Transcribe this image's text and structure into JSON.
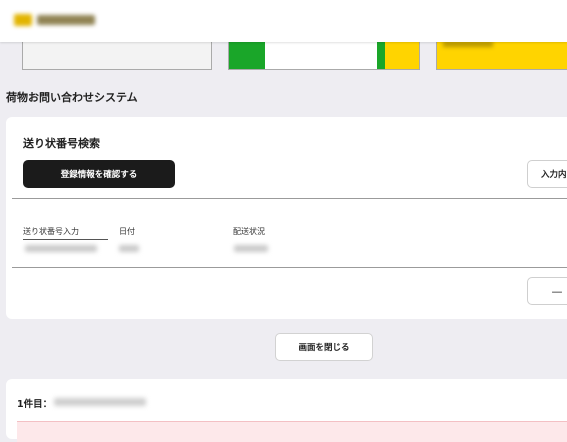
{
  "header": {
    "logo": "logo"
  },
  "banners": [
    "banner-left",
    "banner-middle",
    "banner-right"
  ],
  "page": {
    "title": "荷物お問い合わせシステム"
  },
  "search_card": {
    "title": "送り状番号検索",
    "confirm_button": "登録情報を確認する",
    "side_button": "入力内",
    "columns": [
      "送り状番号入力",
      "日付",
      "配送状況"
    ],
    "small_button": "—"
  },
  "close_button": "画面を閉じる",
  "result": {
    "label": "1件目："
  }
}
